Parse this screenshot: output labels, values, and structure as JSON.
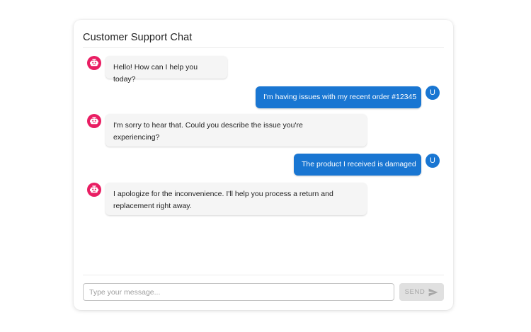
{
  "chat": {
    "title": "Customer Support Chat",
    "user_initial": "U",
    "messages": [
      {
        "sender": "bot",
        "text": "Hello! How can I help you today?"
      },
      {
        "sender": "user",
        "text": "I'm having issues with my recent order #12345"
      },
      {
        "sender": "bot",
        "text": "I'm sorry to hear that. Could you describe the issue you're experiencing?"
      },
      {
        "sender": "user",
        "text": "The product I received is damaged"
      },
      {
        "sender": "bot",
        "text": "I apologize for the inconvenience. I'll help you process a return and replacement right away."
      }
    ]
  },
  "composer": {
    "placeholder": "Type your message...",
    "value": "",
    "send_label": "SEND",
    "send_icon": "send-icon"
  },
  "colors": {
    "bot_avatar": "#e91e63",
    "user_avatar": "#1976d2",
    "user_bubble": "#1976d2",
    "bot_bubble": "#f5f5f5",
    "send_disabled": "#e0e0e0"
  },
  "icons": {
    "bot_avatar_icon": "robot-icon"
  }
}
